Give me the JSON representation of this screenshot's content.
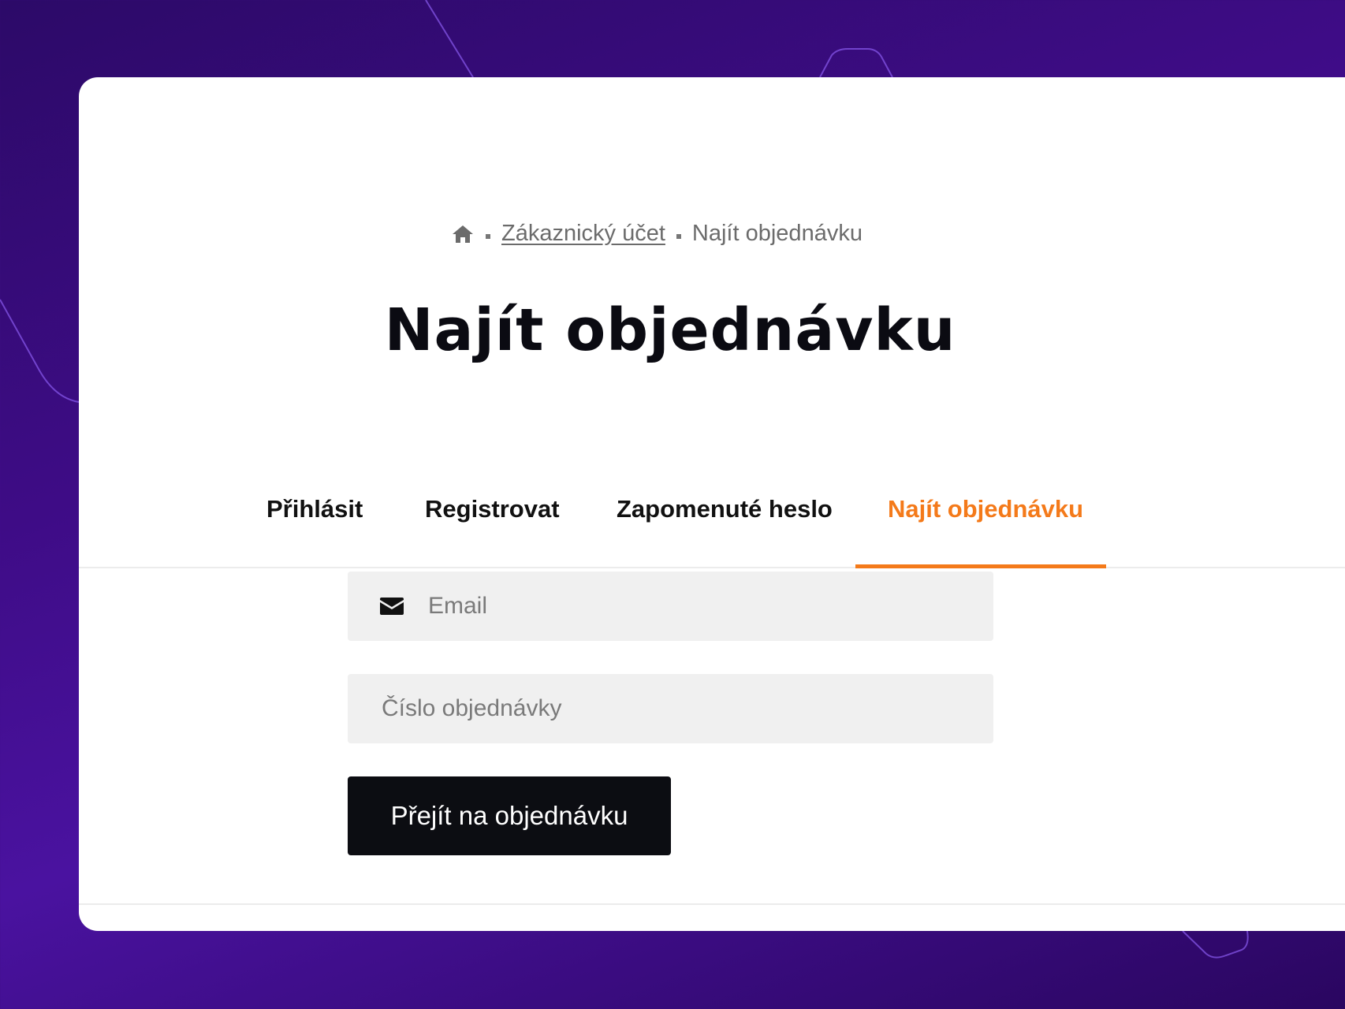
{
  "breadcrumb": {
    "home_icon": "home-icon",
    "account_link": "Zákaznický účet",
    "current": "Najít objednávku"
  },
  "page": {
    "title": "Najít objednávku"
  },
  "tabs": [
    {
      "label": "Přihlásit",
      "active": false
    },
    {
      "label": "Registrovat",
      "active": false
    },
    {
      "label": "Zapomenuté heslo",
      "active": false
    },
    {
      "label": "Najít objednávku",
      "active": true
    }
  ],
  "form": {
    "email_placeholder": "Email",
    "email_icon": "envelope-icon",
    "order_placeholder": "Číslo objednávky",
    "submit_label": "Přejít na objednávku"
  },
  "colors": {
    "accent": "#f47a1a",
    "button_bg": "#0c0d12",
    "background": "#3e0c86"
  }
}
